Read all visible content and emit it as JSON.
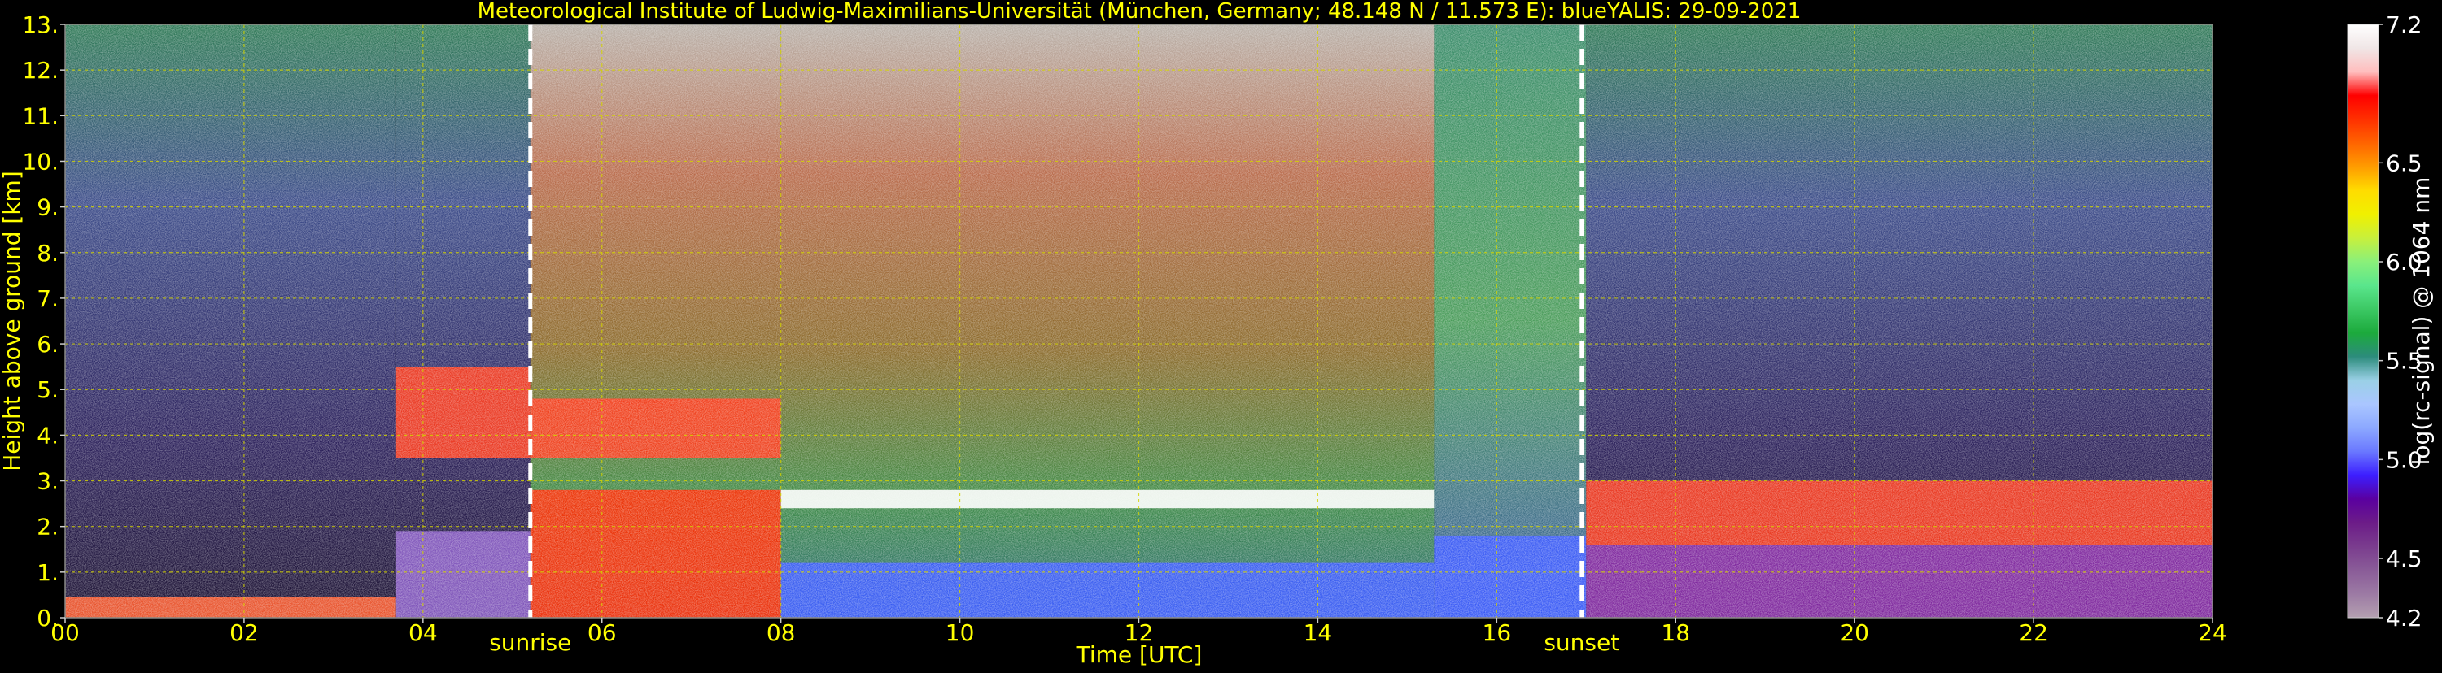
{
  "chart_data": {
    "type": "heatmap",
    "title": "Meteorological Institute of Ludwig-Maximilians-Universität (München, Germany; 48.148 N / 11.573 E):    blueYALIS: 29-09-2021",
    "xlabel": "Time [UTC]",
    "ylabel": "Height above ground [km]",
    "xlim": [
      0,
      24
    ],
    "ylim": [
      0,
      13
    ],
    "x_ticks": [
      "00",
      "02",
      "04",
      "06",
      "08",
      "10",
      "12",
      "14",
      "16",
      "18",
      "20",
      "22",
      "24"
    ],
    "y_ticks": [
      "0.",
      "1.",
      "2.",
      "3.",
      "4.",
      "5.",
      "6.",
      "7.",
      "8.",
      "9.",
      "10.",
      "11.",
      "12.",
      "13."
    ],
    "grid": true,
    "colorbar": {
      "label": "log(rc-signal) @ 1064 nm",
      "range": [
        4.2,
        7.2
      ],
      "ticks": [
        "4.2",
        "4.5",
        "5.0",
        "5.5",
        "6.0",
        "6.5",
        "7.2"
      ],
      "colors": [
        "#b4a0b0",
        "#9c7aa4",
        "#8a5c98",
        "#7a3c8e",
        "#6c1c88",
        "#5a00a0",
        "#3c1eff",
        "#6a78ff",
        "#8ca8ff",
        "#aac6ff",
        "#9ad0e6",
        "#2c8c7c",
        "#1caa3c",
        "#3cc864",
        "#5ae68c",
        "#8af07a",
        "#c8f03c",
        "#f0f000",
        "#ffdc00",
        "#ff9c00",
        "#ff6400",
        "#ff3000",
        "#ff0000",
        "#ffbebe",
        "#f0e6e6",
        "#ffffff"
      ]
    },
    "annotations": [
      {
        "text": "sunrise",
        "x": 5.2
      },
      {
        "text": "sunset",
        "x": 16.95
      }
    ],
    "profile_segments": [
      {
        "t0": 0.0,
        "t1": 3.7,
        "layers": [
          {
            "top": 0.45,
            "kind": "low_aerosol"
          }
        ],
        "background": "dark"
      },
      {
        "t0": 3.7,
        "t1": 5.2,
        "layers": [
          {
            "top": 1.9,
            "kind": "mixed"
          },
          {
            "base": 3.5,
            "top": 5.5,
            "kind": "cloud"
          }
        ],
        "background": "dark"
      },
      {
        "t0": 5.2,
        "t1": 8.0,
        "layers": [
          {
            "top": 2.8,
            "kind": "boundary_layer_strong"
          },
          {
            "base": 3.5,
            "top": 4.8,
            "kind": "cloud"
          }
        ],
        "background": "daylight"
      },
      {
        "t0": 8.0,
        "t1": 15.3,
        "layers": [
          {
            "top": 1.2,
            "kind": "boundary_layer"
          },
          {
            "base": 2.4,
            "top": 2.8,
            "kind": "thin_cloud"
          }
        ],
        "background": "daylight"
      },
      {
        "t0": 15.3,
        "t1": 17.0,
        "layers": [
          {
            "top": 1.8,
            "kind": "boundary_layer"
          }
        ],
        "background": "twilight"
      },
      {
        "t0": 17.0,
        "t1": 24.0,
        "layers": [
          {
            "top": 1.6,
            "kind": "residual_layer"
          },
          {
            "base": 1.6,
            "top": 3.0,
            "kind": "cloud"
          }
        ],
        "background": "dark"
      }
    ]
  }
}
